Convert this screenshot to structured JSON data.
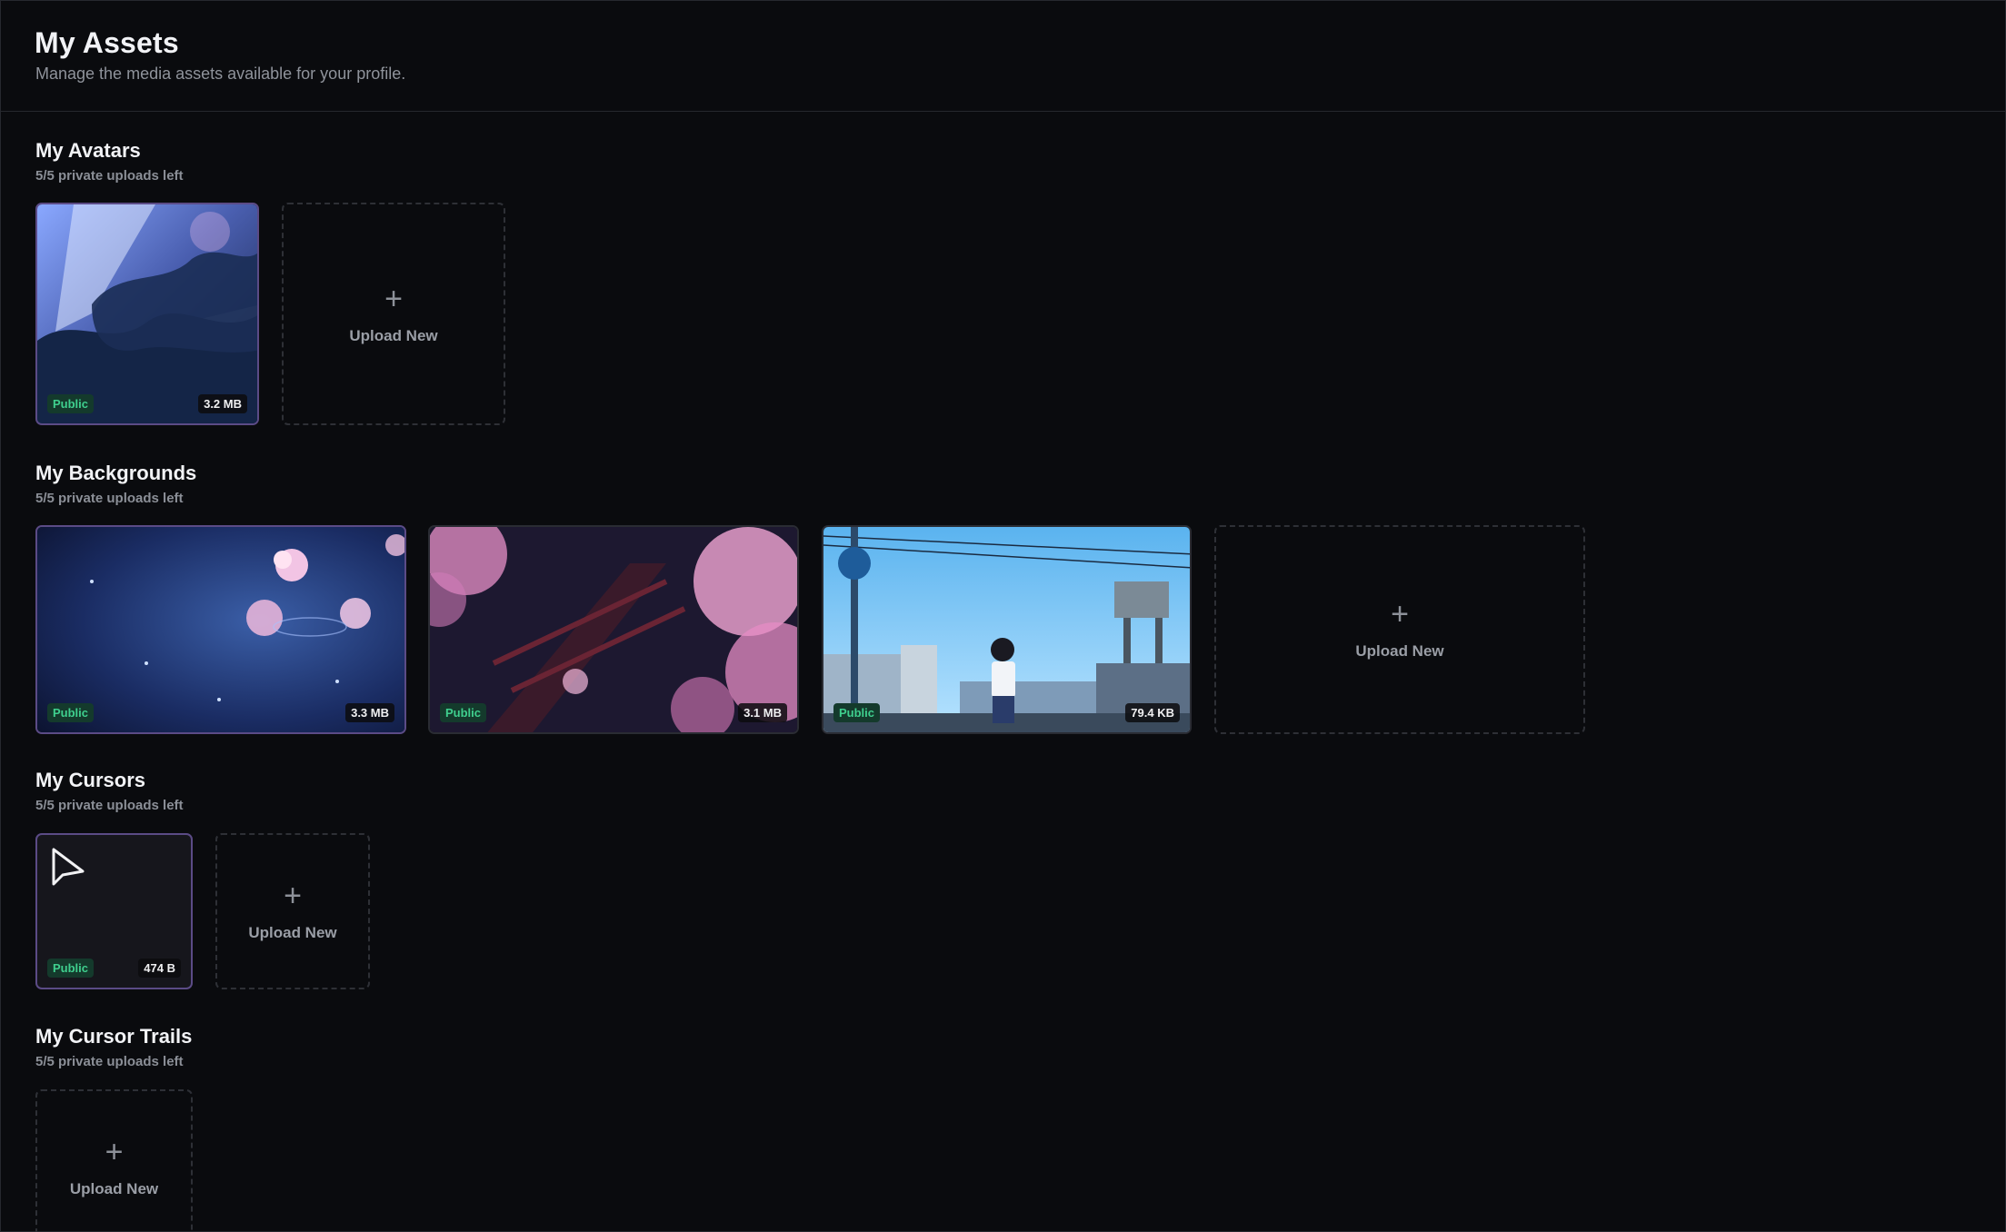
{
  "header": {
    "title": "My Assets",
    "subtitle": "Manage the media assets available for your profile."
  },
  "sections": {
    "avatars": {
      "title": "My Avatars",
      "quota": "5/5 private uploads left",
      "items": [
        {
          "visibility": "Public",
          "size": "3.2 MB"
        }
      ]
    },
    "backgrounds": {
      "title": "My Backgrounds",
      "quota": "5/5 private uploads left",
      "items": [
        {
          "visibility": "Public",
          "size": "3.3 MB"
        },
        {
          "visibility": "Public",
          "size": "3.1 MB"
        },
        {
          "visibility": "Public",
          "size": "79.4 KB"
        }
      ]
    },
    "cursors": {
      "title": "My Cursors",
      "quota": "5/5 private uploads left",
      "items": [
        {
          "visibility": "Public",
          "size": "474 B"
        }
      ]
    },
    "cursor_trails": {
      "title": "My Cursor Trails",
      "quota": "5/5 private uploads left",
      "items": []
    }
  },
  "upload": {
    "label": "Upload New",
    "icon": "plus-icon"
  },
  "colors": {
    "background": "#0a0b0e",
    "public_badge_text": "#3fcf8e",
    "public_badge_bg": "#143a2c",
    "selected_border": "#5b4b86"
  }
}
